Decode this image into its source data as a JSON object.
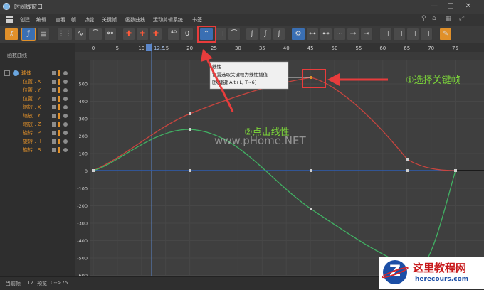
{
  "window": {
    "title": "时间线窗口"
  },
  "menu": {
    "items": [
      "创建",
      "编辑",
      "查看",
      "帧",
      "功能",
      "关键帧",
      "函数曲线",
      "运动剪辑系统",
      "书签"
    ]
  },
  "left_panel": {
    "header": "函数曲线",
    "root": "球体",
    "tracks": [
      "位置 . X",
      "位置 . Y",
      "位置 . Z",
      "缩放 . X",
      "缩放 . Y",
      "缩放 . Z",
      "旋转 . P",
      "旋转 . H",
      "旋转 . B"
    ]
  },
  "timeline": {
    "frame_ticks": [
      "0",
      "5",
      "10",
      "15",
      "20",
      "25",
      "30",
      "35",
      "40",
      "45",
      "50",
      "55",
      "60",
      "65",
      "70",
      "75"
    ],
    "current_frame_label": "12.5",
    "value_ticks": [
      "500",
      "400",
      "300",
      "200",
      "100",
      "0",
      "-100",
      "-200",
      "-300",
      "-400",
      "-500",
      "-600"
    ]
  },
  "tooltip": {
    "title": "线性",
    "description": "设置选取关键帧为线性插值",
    "shortcut": "[快捷键 Alt+L, T~6]"
  },
  "annotations": {
    "step1": "①选择关键帧",
    "step2": "②点击线性"
  },
  "watermark": {
    "center": "www.pHome.NET",
    "logo_letter": "Z",
    "site_cn": "这里教程网",
    "site_en": "herecours.com"
  },
  "status": {
    "current_frame_label": "当前帧",
    "current_frame_value": "12",
    "preview_label": "预览",
    "preview_value": "0-->75"
  },
  "colors": {
    "accent": "#e0902a",
    "highlight_red": "#e83c3c",
    "annotation_green": "#7cd63a",
    "curve_red": "#c8453f",
    "curve_green": "#41b163",
    "curve_blue": "#2f5db0"
  },
  "icons": {
    "toolbar": [
      "key-icon",
      "motion-path-icon",
      "film-icon",
      "dope-sheet-icon",
      "waveform-icon",
      "curve-overview-icon",
      "link-icon",
      "add-key-icon",
      "add-key-alt-icon",
      "delete-key-icon",
      "frame-all-icon",
      "frame-selected-icon",
      "rotate-icon",
      "zero-icon",
      "linear-icon",
      "step-icon",
      "spline-icon",
      "ease-in-icon",
      "ease-out-icon",
      "ease-both-icon",
      "tangent-icon",
      "tangent-alt-icon",
      "clamp-icon",
      "break-tangent-icon",
      "unify-tangent-icon",
      "lock-icon",
      "lock-time-icon",
      "lock-value-icon",
      "mute-icon",
      "lock-angle-icon",
      "padlock-icon",
      "key-settings-icon"
    ],
    "window_right": [
      "search-icon",
      "home-icon",
      "grid-icon",
      "expand-icon"
    ]
  }
}
